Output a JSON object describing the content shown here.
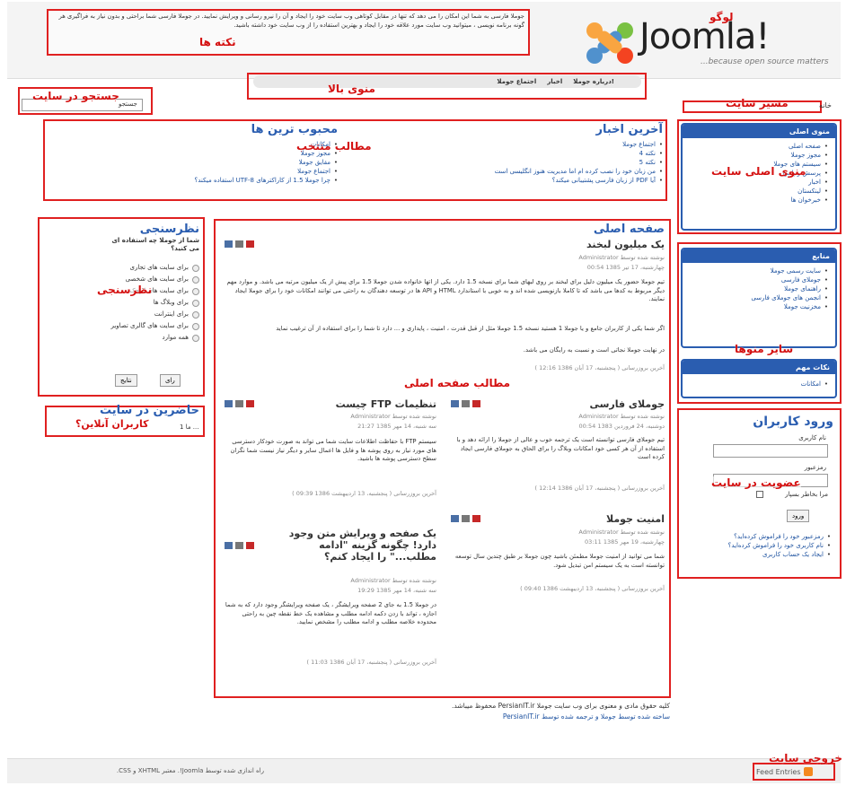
{
  "header": {
    "notice_text": "جوملا فارسی به شما این امکان را می دهد که تنها در مقابل کوتاهی وب سایت خود را ایجاد و آن را نیرو رسانی و ویرایش نمایید. در جوملا فارسی شما براحتی و بدون نیاز به فراگیری هر گونه برنامه نویسی ، میتوانید وب سایت مورد علاقه خود را ایجاد و بهترین استفاده را از وب سایت خود داشته باشید.",
    "notice_annotation": "نکته ها",
    "logo_text": "Joomla!",
    "logo_annotation": "لوگو",
    "tagline": "...because open source matters",
    "top_menu": [
      "درباره جوملا!",
      "اخبار",
      "اجتماع جوملا"
    ],
    "top_menu_annotation": "منوی بالا"
  },
  "search": {
    "label": "جستجو",
    "annotation": "جستجو در سایت"
  },
  "breadcrumb": {
    "home": "خانه",
    "annotation": "مسیر سایت"
  },
  "featured": {
    "annotation": "مطالب منتخب",
    "latest_title": "آخرین اخبار",
    "latest_items": [
      "اجتماع جوملا",
      "نکته 4",
      "نکته 5",
      "من زبان خود را نصب کرده ام اما مدیریت هنوز انگلیسی است",
      "آیا PDF از زبان فارسی پشتیبانی میکند؟"
    ],
    "popular_title": "محبوب ترین ها",
    "popular_items": [
      "امکانات",
      "مجوز جوملا",
      "مقایق جوملا",
      "اجتماع جوملا",
      "چرا جوملا 1.5 از کاراکترهای UTF-8 استفاده میکند؟"
    ]
  },
  "main_menu": {
    "title": "منوی اصلی",
    "annotation": "منوی اصلی سایت",
    "items": [
      "صفحه اصلی",
      "مجوز جوملا",
      "سیستم های جوملا",
      "پرسش و پاسخ",
      "اخبار",
      "لینکستان",
      "خبرخوان ها"
    ]
  },
  "resources": {
    "title": "منابع",
    "items": [
      "سایت رسمی جوملا",
      "جوملای فارسی",
      "راهنمای جوملا",
      "انجمن های جوملای فارسی",
      "مخزنیت جوملا"
    ],
    "annotation": "سایر منوها"
  },
  "key_concepts": {
    "title": "نکات مهم",
    "items": [
      "امکانات"
    ]
  },
  "poll": {
    "title": "نظرسنجی",
    "annotation": "نظرسنجی",
    "question": "شما از جوملا چه استفاده ای می کنید؟",
    "options": [
      "برای سایت های تجاری",
      "برای سایت های شخصی",
      "برای سایت های کوچک",
      "برای وبلاگ ها",
      "برای اینترانت",
      "برای سایت های گالری تصاویر",
      "همه موارد"
    ],
    "vote_btn": "رای",
    "results_btn": "نتایج"
  },
  "whos_online": {
    "title": "حاضرین در سایت",
    "annotation": "کاربران آنلاین؟",
    "text": "ما 1 ..."
  },
  "content": {
    "heading": "صفحه اصلی",
    "annotation": "مطالب صفحه اصلی",
    "lead": {
      "title": "یک میلیون لبخند",
      "author": "نوشته شده توسط Administrator",
      "date": "چهارشنبه، 17 تیر 1385 00:54",
      "p1": "تیم جوملا حضور یک میلیون دلیل برای لبخند بر روی لبهای شما برای نسخه 1.5 دارد. یکی از اتها خانواده شدن جوملا 1.5 برای پیش از یک میلیون مرتبه می باشد. و موارد مهم دیگر مربوط به کدها می باشد که تا کاملا بازنویسی شده اند و به خوبی با استاندارد HTML و API ها در توسعه دهندگان به راحتی می توانند امکانات خود را برای جوملا ایجاد نمایند.",
      "p2": "اگر شما یکی از کاربران جامع و یا جوملا 1 هستید نسخه 1.5 جوملا مثل از قبل قدرت ، امنیت ، پایداری و ... دارد تا شما را برای استفاده از آن ترغیب نماید",
      "p3": "در نهایت جوملا نجاتی است و نسبت به رایگان می باشد.",
      "updated": "آخرین بروزرسانی ( پنجشنبه، 17 آبان 1386 12:16 )"
    },
    "articles": [
      {
        "title": "جوملای فارسی",
        "author": "نوشته شده توسط Administrator",
        "date": "دوشنبه، 24 فروردین 1383 00:54",
        "text": "تیم جوملای فارسی توانسته است یک ترجمه خوب و عالی از جوملا را ارائه دهد و با استفاده از آن هر کسی خود امکانات وبلاگ را برای الحاق به جوملای فارسی ایجاد کرده است",
        "updated": "آخرین بروزرسانی ( پنجشنبه، 17 آبان 1386 12:14 )"
      },
      {
        "title": "تنظیمات FTP چیست",
        "author": "نوشته شده توسط Administrator",
        "date": "سه شنبه، 14 مهر 1385 21:27",
        "text": "سیستم FTP با حفاظت اطلاعات سایت شما می تواند به صورت خودکار دسترسی های مورد نیاز به روی پوشه ها و فایل ها اعمال سایر و دیگر نیاز نیست شما نگران سطح دسترسی پوشه ها باشید.",
        "updated": "آخرین بروزرسانی ( پنجشنبه، 13 اردیبهشت 1386 09:39 )"
      },
      {
        "title": "امنیت جوملا",
        "author": "نوشته شده توسط Administrator",
        "date": "چهارشنبه، 19 مهر 1385 03:11",
        "text": "شما می توانید از امنیت جوملا مطمئن باشید چون جوملا بر طبق چندین سال توسعه توانسته است به یک سیستم امن تبدیل شود.",
        "updated": "آخرین بروزرسانی ( پنجشنبه، 13 اردیبهشت 1386 09:40 )"
      },
      {
        "title": "یک صفحه و ویرایش متن وجود دارد! چگونه گزینه \"ادامه مطلب...\" را ایجاد کنم؟",
        "author": "نوشته شده توسط Administrator",
        "date": "سه شنبه، 14 مهر 1385 19:29",
        "text": "در جوملا 1.5 به جای 2 صفحه ویرایشگر ، یک صفحه ویرایشگر وجود دارد که به شما اجازه ، تواند با زدن دکمه ادامه مطلب و مشاهده یک خط نقطه چین به راحتی محدوده خلاصه مطلب و ادامه مطلب را مشخص نمایید.",
        "updated": "آخرین بروزرسانی ( پنجشنبه، 17 آبان 1386 11:03 )"
      }
    ]
  },
  "login": {
    "title": "ورود کاربران",
    "annotation": "عضویت در سایت",
    "username_label": "نام کاربری",
    "password_label": "رمزعبور",
    "remember_label": "مرا بخاطر بسپار",
    "login_btn": "ورود",
    "links": [
      "رمزعبور خود را فراموش کرده‌اید؟",
      "نام کاربری خود را فراموش کرده‌اید؟",
      "ایجاد یک حساب کاربری"
    ]
  },
  "footer": {
    "copyright": "کلیه حقوق مادی و معنوی برای وب سایت جوملا PersianIT.ir محفوظ میباشد.",
    "credits": "ساخته شده توسط جوملا و ترجمه شده توسط PersianIT.ir",
    "validation": "راه اندازی شده توسط Joomla!. معتبر XHTML و CSS.",
    "feed": "Feed Entries",
    "feed_annotation": "خروجی سایت"
  }
}
